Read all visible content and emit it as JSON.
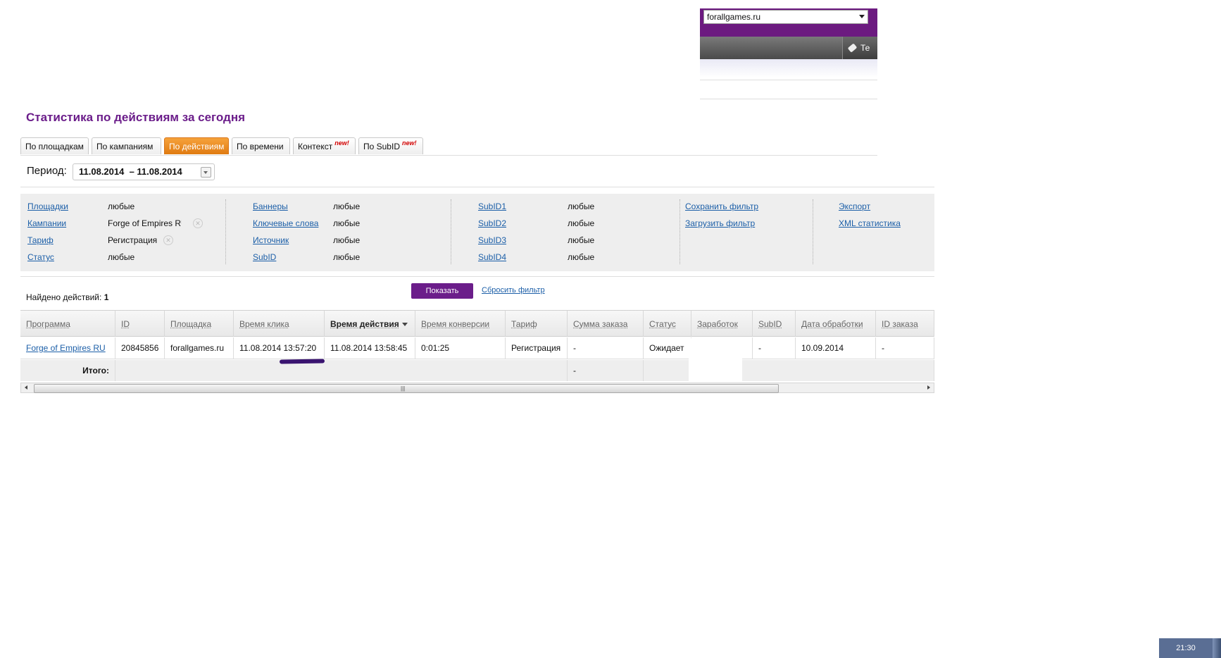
{
  "header": {
    "site_select_value": "forallgames.ru",
    "header_button_label": "Те"
  },
  "page_title": "Статистика по действиям за сегодня",
  "tabs": [
    {
      "label": "По площадкам",
      "active": false,
      "new": ""
    },
    {
      "label": "По кампаниям",
      "active": false,
      "new": ""
    },
    {
      "label": "По действиям",
      "active": true,
      "new": ""
    },
    {
      "label": "По времени",
      "active": false,
      "new": ""
    },
    {
      "label": "Контекст",
      "active": false,
      "new": "new!"
    },
    {
      "label": "По SubID",
      "active": false,
      "new": "new!"
    }
  ],
  "period": {
    "label": "Период:",
    "value": "11.08.2014  – 11.08.2014"
  },
  "filters": {
    "col1": [
      {
        "label": "Площадки",
        "value": "любые"
      },
      {
        "label": "Кампании",
        "value": "Forge of Empires RU"
      },
      {
        "label": "Тариф",
        "value": "Регистрация"
      },
      {
        "label": "Статус",
        "value": "любые"
      }
    ],
    "col2": [
      {
        "label": "Баннеры",
        "value": "любые"
      },
      {
        "label": "Ключевые слова",
        "value": "любые"
      },
      {
        "label": "Источник",
        "value": "любые"
      },
      {
        "label": "SubID",
        "value": "любые"
      }
    ],
    "col3": [
      {
        "label": "SubID1",
        "value": "любые"
      },
      {
        "label": "SubID2",
        "value": "любые"
      },
      {
        "label": "SubID3",
        "value": "любые"
      },
      {
        "label": "SubID4",
        "value": "любые"
      }
    ],
    "col4": [
      "Сохранить фильтр",
      "Загрузить фильтр"
    ],
    "col5": [
      "Экспорт",
      "XML статистика"
    ],
    "clear_icon": "x-icon"
  },
  "actions": {
    "found_label": "Найдено действий:",
    "found_count": "1",
    "show_button": "Показать",
    "reset_link": "Сбросить фильтр"
  },
  "table": {
    "columns": [
      "Программа",
      "ID",
      "Площадка",
      "Время клика",
      "Время действия",
      "Время конверсии",
      "Тариф",
      "Сумма заказа",
      "Статус",
      "Заработок",
      "SubID",
      "Дата обработки",
      "ID заказа"
    ],
    "rows": [
      [
        "Forge of Empires RU",
        "20845856",
        "forallgames.ru",
        "11.08.2014 13:57:20",
        "11.08.2014 13:58:45",
        "0:01:25",
        "Регистрация",
        "-",
        "Ожидает",
        "",
        "-",
        "10.09.2014",
        "-"
      ]
    ],
    "footer_label": "Итого:",
    "footer_sum": "-",
    "sorted_column": "Время действия"
  },
  "taskbar": {
    "clock": "21:30"
  },
  "colors": {
    "brand_purple": "#6b1d8a",
    "active_tab": "#f08c1c",
    "link": "#1c5fa8"
  }
}
